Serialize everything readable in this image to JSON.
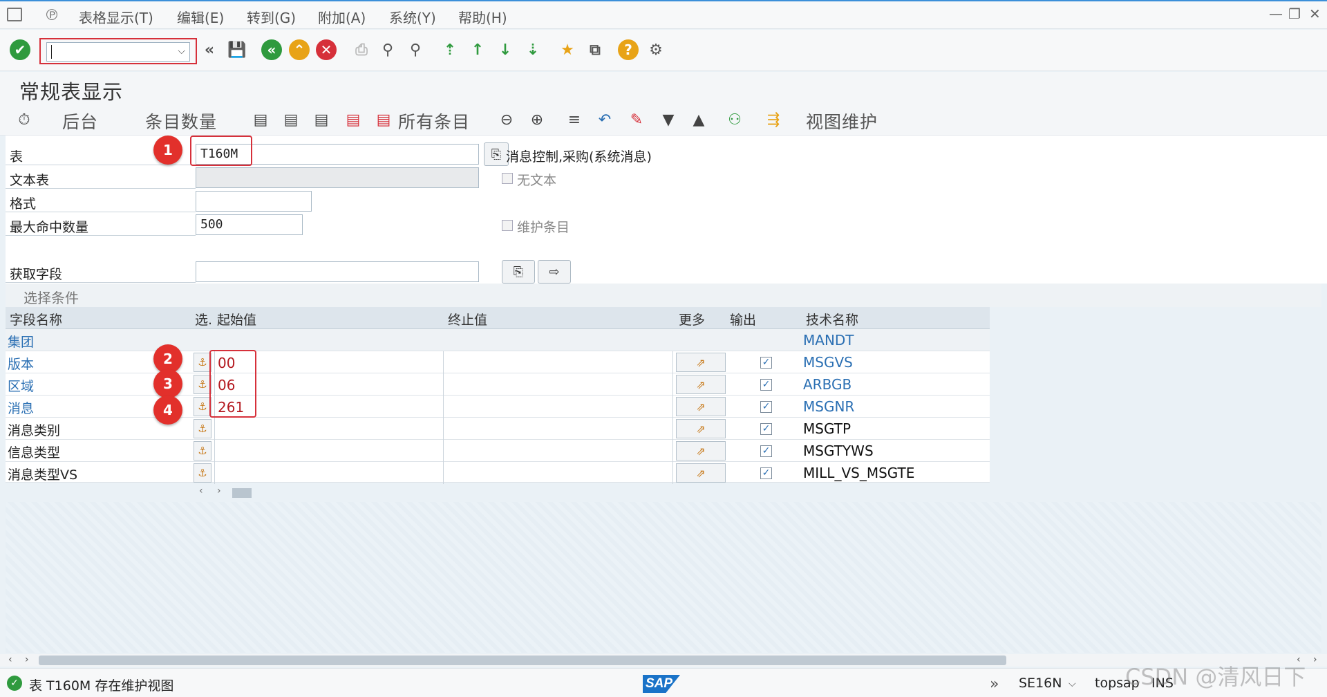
{
  "menu": {
    "items": [
      "表格显示(T)",
      "编辑(E)",
      "转到(G)",
      "附加(A)",
      "系统(Y)",
      "帮助(H)"
    ],
    "window_controls": [
      "—",
      "❐",
      "✕"
    ]
  },
  "toolbar": {
    "command_field_value": ""
  },
  "page": {
    "title": "常规表显示"
  },
  "app_toolbar": {
    "background_label": "后台",
    "entry_count_label": "条目数量",
    "all_entries_label": "所有条目",
    "view_maintenance_label": "视图维护"
  },
  "form": {
    "table_label": "表",
    "table_value": "T160M",
    "table_description": "消息控制,采购(系统消息)",
    "text_table_label": "文本表",
    "text_table_value": "",
    "no_text_label": "无文本",
    "format_label": "格式",
    "format_value": "",
    "max_hits_label": "最大命中数量",
    "max_hits_value": "500",
    "maintain_entries_label": "维护条目",
    "get_fields_label": "获取字段",
    "get_fields_value": ""
  },
  "selection": {
    "section_title": "选择条件",
    "headers": {
      "field_name": "字段名称",
      "option": "选.",
      "from_value": "起始值",
      "to_value": "终止值",
      "more": "更多",
      "output": "输出",
      "tech_name": "技术名称"
    },
    "rows": [
      {
        "name": "集团",
        "from": "",
        "to": "",
        "output": false,
        "tech": "MANDT"
      },
      {
        "name": "版本",
        "from": "00",
        "to": "",
        "output": true,
        "tech": "MSGVS"
      },
      {
        "name": "区域",
        "from": "06",
        "to": "",
        "output": true,
        "tech": "ARBGB"
      },
      {
        "name": "消息",
        "from": "261",
        "to": "",
        "output": true,
        "tech": "MSGNR"
      },
      {
        "name": "消息类别",
        "from": "",
        "to": "",
        "output": true,
        "tech": "MSGTP"
      },
      {
        "name": "信息类型",
        "from": "",
        "to": "",
        "output": true,
        "tech": "MSGTYWS"
      },
      {
        "name": "消息类型VS",
        "from": "",
        "to": "",
        "output": true,
        "tech": "MILL_VS_MSGTE"
      }
    ]
  },
  "markers": [
    "1",
    "2",
    "3",
    "4"
  ],
  "status": {
    "message": "表 T160M 存在维护视图",
    "logo": "SAP",
    "tcode": "SE16N",
    "server": "topsap",
    "mode": "INS"
  },
  "watermark": "CSDN @清风日下",
  "colors": {
    "link_blue": "#2a6fb3",
    "value_red": "#b3171e",
    "ok_green": "#2f9a3e",
    "annotation_red": "#e2302b"
  }
}
